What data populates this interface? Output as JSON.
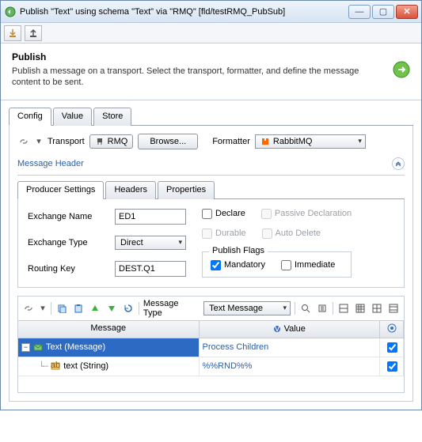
{
  "window": {
    "title": "Publish \"Text\" using schema \"Text\" via \"RMQ\" [fld/testRMQ_PubSub]"
  },
  "desc": {
    "heading": "Publish",
    "text": "Publish a message on a transport. Select the transport, formatter, and define the message content to be sent."
  },
  "tabs": {
    "config": "Config",
    "value": "Value",
    "store": "Store"
  },
  "transport": {
    "label": "Transport",
    "value": "RMQ",
    "browse": "Browse...",
    "formatter_label": "Formatter",
    "formatter_value": "RabbitMQ"
  },
  "section": {
    "header": "Message Header"
  },
  "inner_tabs": {
    "producer": "Producer Settings",
    "headers": "Headers",
    "properties": "Properties"
  },
  "producer": {
    "exchange_name_label": "Exchange Name",
    "exchange_name_value": "ED1",
    "exchange_type_label": "Exchange Type",
    "exchange_type_value": "Direct",
    "routing_key_label": "Routing Key",
    "routing_key_value": "DEST.Q1",
    "declare": "Declare",
    "passive": "Passive Declaration",
    "durable": "Durable",
    "autodelete": "Auto Delete",
    "publish_flags": "Publish Flags",
    "mandatory": "Mandatory",
    "immediate": "Immediate"
  },
  "grid_toolbar": {
    "message_type_label": "Message Type",
    "message_type_value": "Text Message"
  },
  "grid": {
    "col_message": "Message",
    "col_value": "Value",
    "rows": [
      {
        "label": "Text (Message)",
        "value": "Process Children",
        "checked": true
      },
      {
        "label": "text (String)",
        "value": "%%RND%%",
        "checked": true
      }
    ]
  }
}
